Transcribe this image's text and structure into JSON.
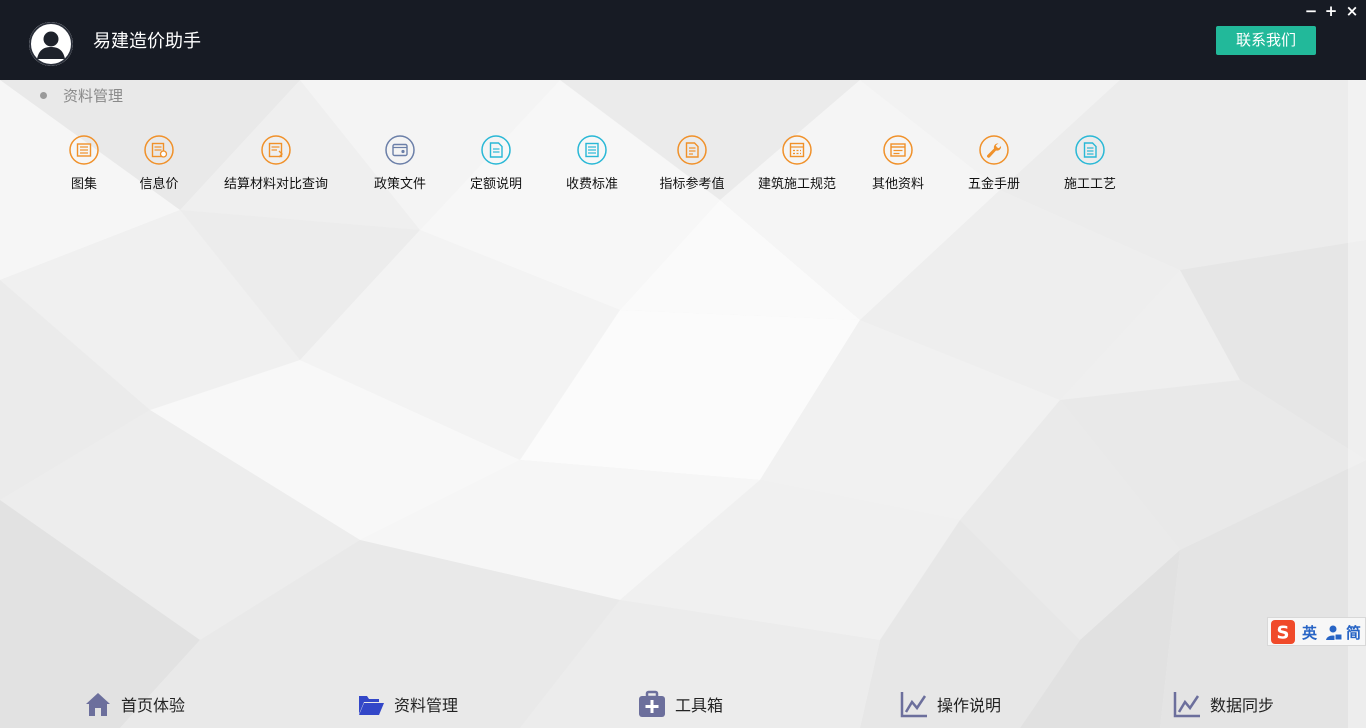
{
  "header": {
    "app_title": "易建造价助手",
    "contact_label": "联系我们",
    "minimize_glyph": "−",
    "maximize_glyph": "+",
    "close_glyph": "×",
    "accent_color": "#22b99a",
    "bar_color": "#171b24"
  },
  "section": {
    "title": "资料管理"
  },
  "categories": [
    {
      "label": "图集",
      "icon": "atlas-icon",
      "color": "#f0912a"
    },
    {
      "label": "信息价",
      "icon": "price-info-icon",
      "color": "#f0912a"
    },
    {
      "label": "结算材料对比查询",
      "icon": "material-compare-icon",
      "color": "#f0912a"
    },
    {
      "label": "政策文件",
      "icon": "policy-file-icon",
      "color": "#6b7fa8"
    },
    {
      "label": "定额说明",
      "icon": "quota-doc-icon",
      "color": "#29b8d6"
    },
    {
      "label": "收费标准",
      "icon": "fee-standard-icon",
      "color": "#29b8d6"
    },
    {
      "label": "指标参考值",
      "icon": "index-ref-icon",
      "color": "#f0912a"
    },
    {
      "label": "建筑施工规范",
      "icon": "construction-spec-icon",
      "color": "#f0912a"
    },
    {
      "label": "其他资料",
      "icon": "other-docs-icon",
      "color": "#f0912a"
    },
    {
      "label": "五金手册",
      "icon": "wrench-icon",
      "color": "#f0912a"
    },
    {
      "label": "施工工艺",
      "icon": "process-doc-icon",
      "color": "#29b8d6"
    }
  ],
  "ime": {
    "logo": "S",
    "mode": "英",
    "script": "简"
  },
  "bottom_nav": [
    {
      "label": "首页体验",
      "icon": "home-icon",
      "color": "#6c6f9c"
    },
    {
      "label": "资料管理",
      "icon": "folder-open-icon",
      "color": "#3347c8"
    },
    {
      "label": "工具箱",
      "icon": "toolbox-icon",
      "color": "#6c6f9c"
    },
    {
      "label": "操作说明",
      "icon": "line-chart-icon",
      "color": "#6c6f9c"
    },
    {
      "label": "数据同步",
      "icon": "sync-chart-icon",
      "color": "#6c6f9c"
    }
  ]
}
